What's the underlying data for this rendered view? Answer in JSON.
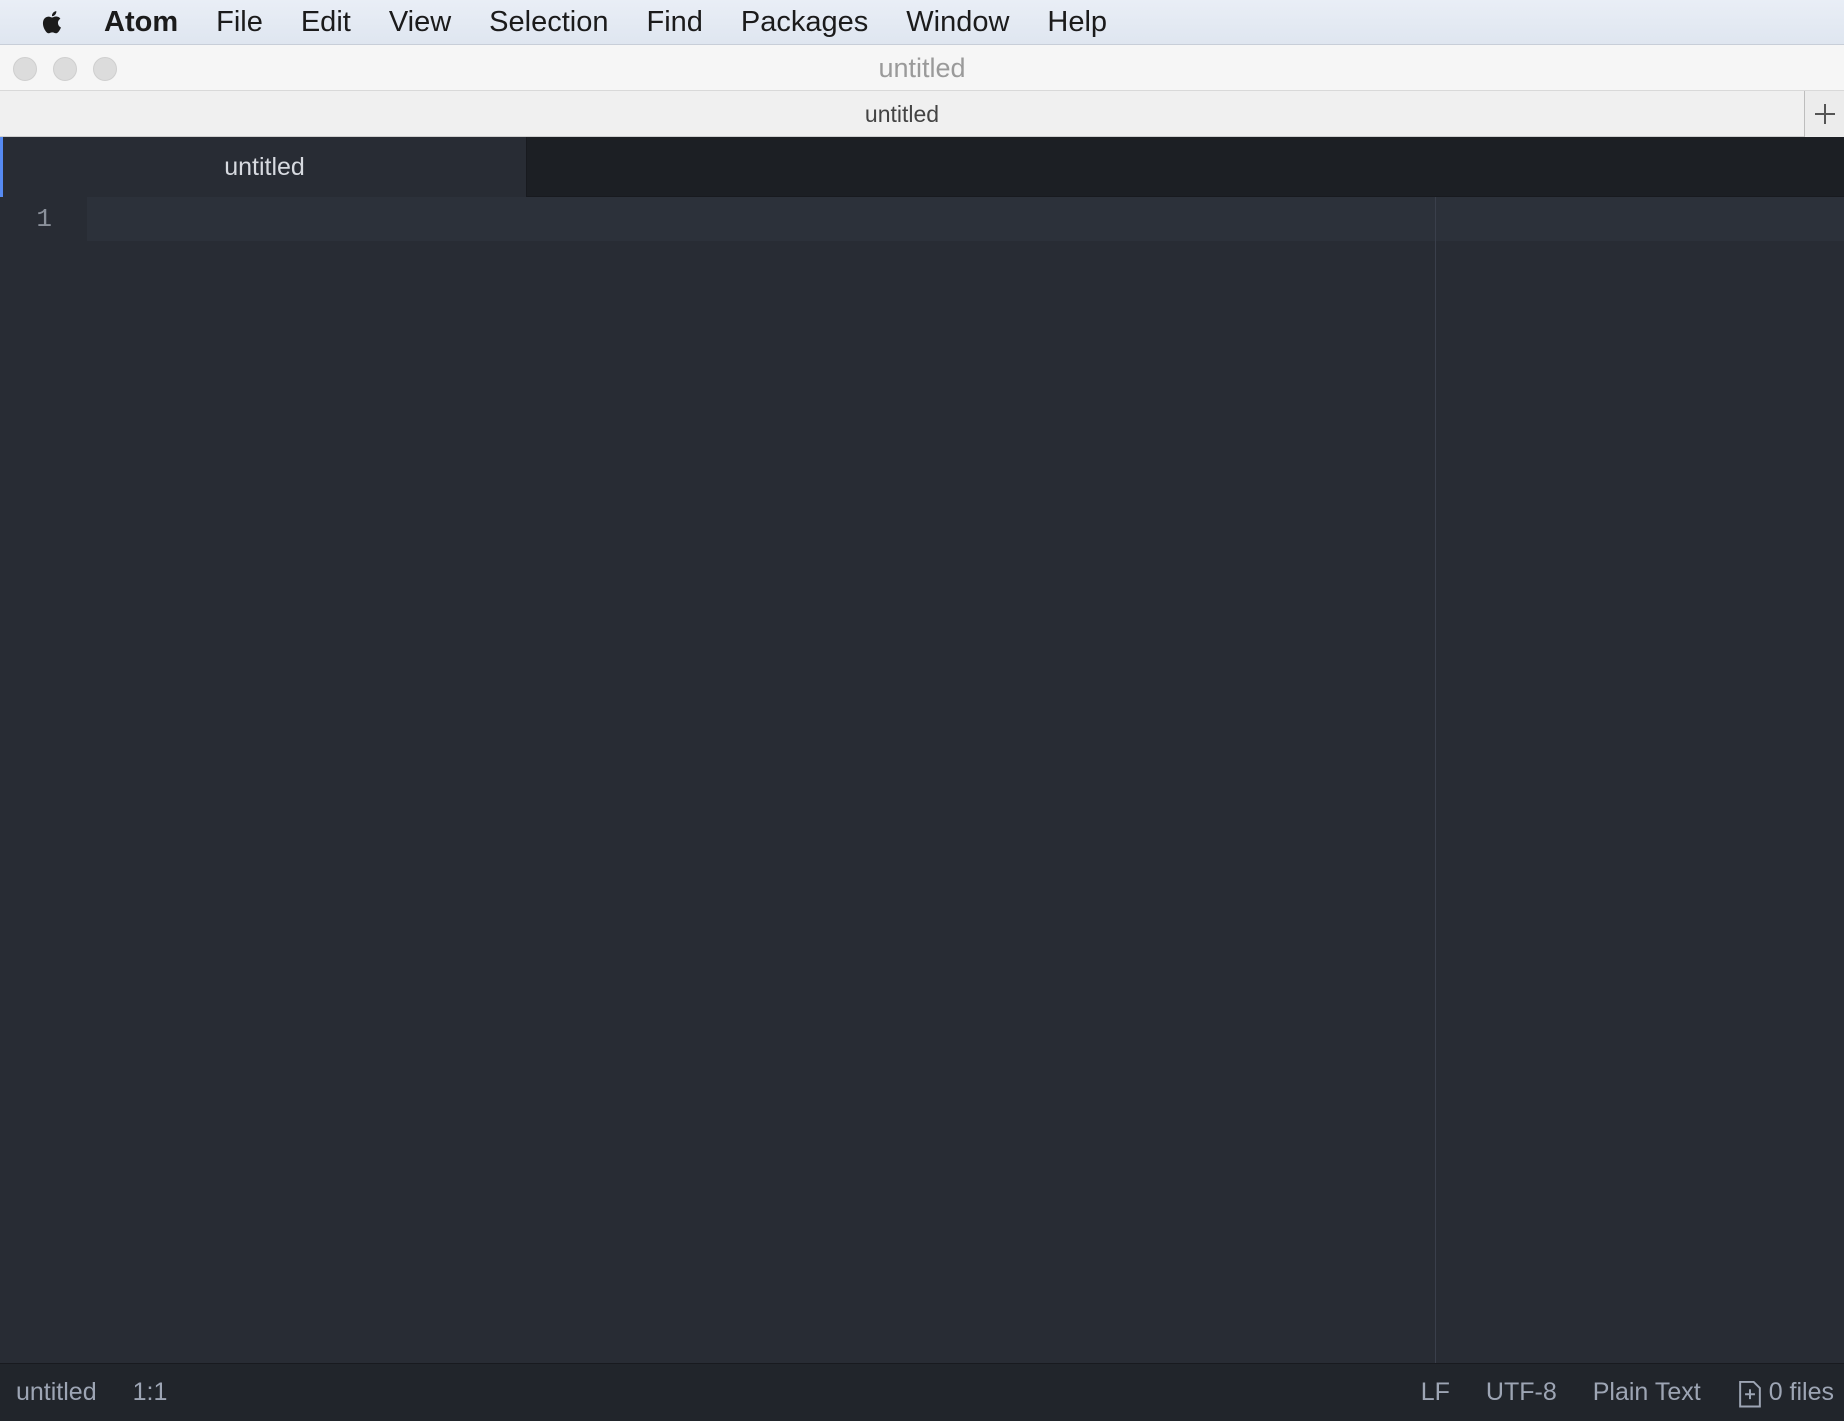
{
  "menubar": {
    "app_name": "Atom",
    "items": [
      "File",
      "Edit",
      "View",
      "Selection",
      "Find",
      "Packages",
      "Window",
      "Help"
    ]
  },
  "window": {
    "title": "untitled"
  },
  "native_tabs": {
    "label": "untitled",
    "new_tab_icon": "plus-icon"
  },
  "editor_tabs": [
    {
      "label": "untitled",
      "active": true
    }
  ],
  "editor": {
    "line_numbers": [
      "1"
    ],
    "content": ""
  },
  "statusbar": {
    "file_name": "untitled",
    "cursor_position": "1:1",
    "line_ending": "LF",
    "encoding": "UTF-8",
    "grammar": "Plain Text",
    "file_count": "0 files"
  },
  "colors": {
    "accent": "#568af2",
    "editor_bg": "#282c34",
    "ui_bg": "#21252b"
  }
}
